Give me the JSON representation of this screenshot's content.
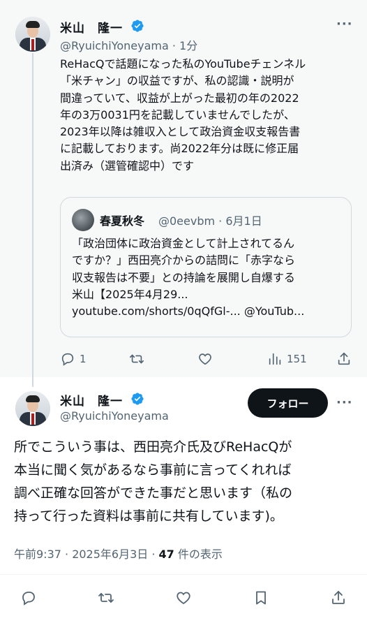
{
  "reply": {
    "author_name": "米山　隆一",
    "handle": "@RyuichiYoneyama",
    "time": "· 1分",
    "lines": [
      "ReHacQで話題になった私のYouTubeチェンネル",
      "「米チャン」の収益ですが、私の認識・説明が",
      "間違っていて、収益が上がった最初の年の2022",
      "年の3万0031円を記載していませんでしたが、",
      "2023年以降は雑収入として政治資金収支報告書",
      "に記載しております。尚2022年分は既に修正届",
      "出済み（選管確認中）です"
    ],
    "quote": {
      "author_name": "春夏秋冬",
      "handle_time": "@0eevbm · 6月1日",
      "lines": [
        "「政治団体に政治資金として計上されてるん",
        "ですか？」西田亮介からの詰問に「赤字なら",
        "収支報告は不要」との持論を展開し自爆する",
        "米山【2025年4月29...",
        "youtube.com/shorts/0qQfGl-... @YouTub..."
      ]
    },
    "actions": {
      "reply_count": "1",
      "retweet_count": "",
      "like_count": "",
      "views_count": "151"
    }
  },
  "main": {
    "author_name": "米山　隆一",
    "handle": "@RyuichiYoneyama",
    "follow_label": "フォロー",
    "lines": [
      "所でこういう事は、西田亮介氏及びReHacQが",
      "本当に聞く気があるなら事前に言ってくれれば",
      "調べ正確な回答ができた事だと思います（私の",
      "持って行った資料は事前に共有しています)。"
    ],
    "timestamp": "午前9:37 · 2025年6月3日 · ",
    "views_number": "47",
    "views_suffix": " 件の表示"
  },
  "colors": {
    "verified": "#1d9bf0",
    "text_primary": "#0f1419",
    "text_secondary": "#536471",
    "follow_bg": "#0f1419"
  },
  "icons": [
    "verified-badge-icon",
    "more-icon",
    "reply-icon",
    "retweet-icon",
    "like-icon",
    "views-icon",
    "share-icon",
    "bookmark-icon"
  ]
}
